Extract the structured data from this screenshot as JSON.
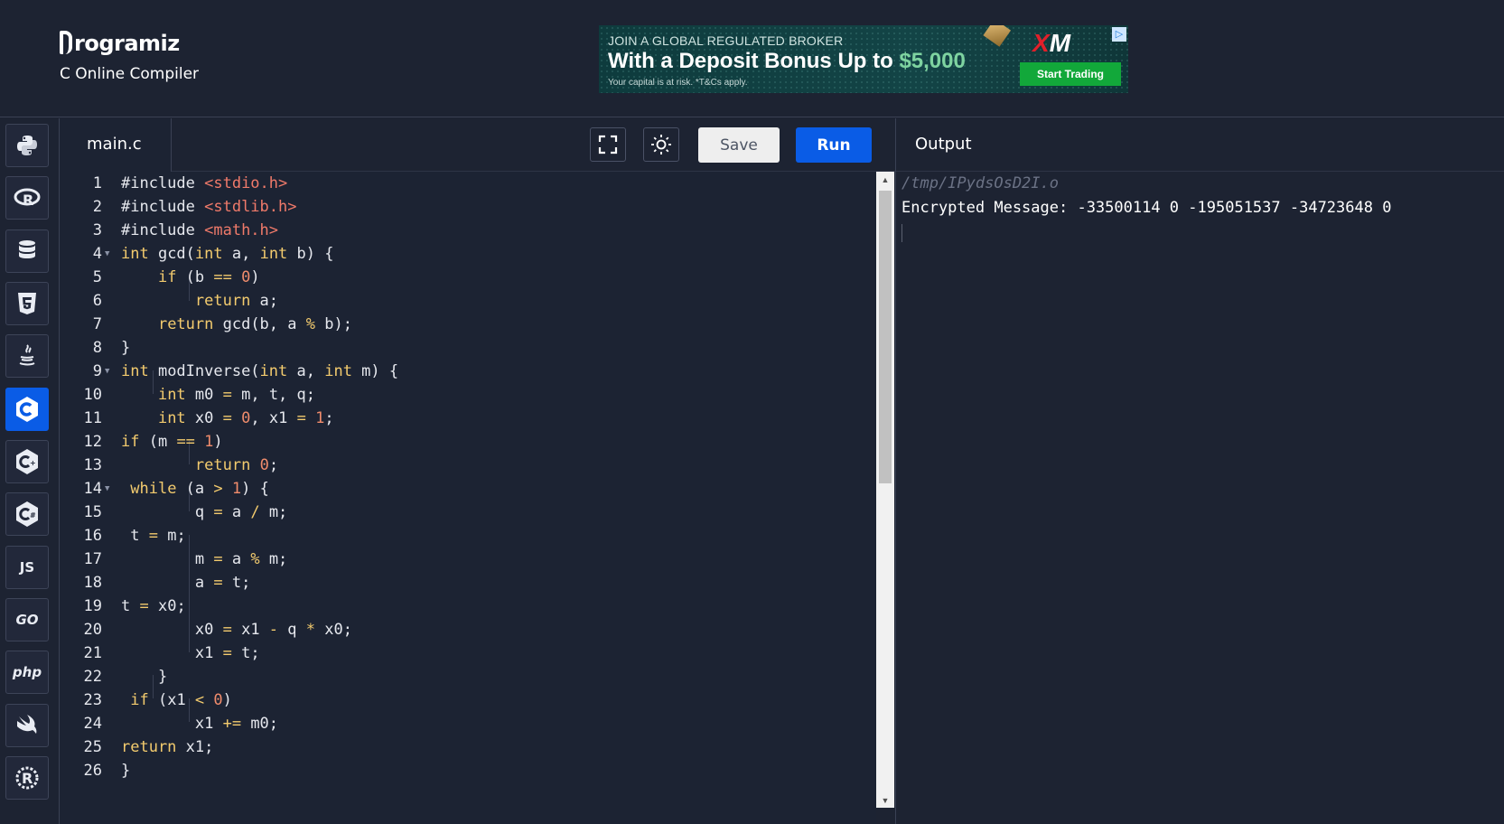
{
  "brand": {
    "name": "rogramiz",
    "subtitle": "C Online Compiler"
  },
  "ad": {
    "line1": "JOIN A GLOBAL REGULATED BROKER",
    "line2_prefix": "With a Deposit Bonus Up to ",
    "line2_amount": "$5,000",
    "line3": "Your capital is at risk. *T&Cs apply.",
    "logo_x": "X",
    "logo_m": "M",
    "badge": "▷",
    "cta": "Start Trading"
  },
  "sidebar": {
    "items": [
      {
        "name": "python",
        "label": ""
      },
      {
        "name": "r",
        "label": ""
      },
      {
        "name": "sql",
        "label": ""
      },
      {
        "name": "html",
        "label": ""
      },
      {
        "name": "java",
        "label": ""
      },
      {
        "name": "c",
        "label": ""
      },
      {
        "name": "cpp",
        "label": ""
      },
      {
        "name": "csharp",
        "label": ""
      },
      {
        "name": "js",
        "label": "JS"
      },
      {
        "name": "go",
        "label": "GO"
      },
      {
        "name": "php",
        "label": "php"
      },
      {
        "name": "swift",
        "label": ""
      },
      {
        "name": "rust",
        "label": ""
      }
    ],
    "active": "c"
  },
  "editor": {
    "tab": "main.c",
    "save_label": "Save",
    "run_label": "Run",
    "line_numbers": [
      "1",
      "2",
      "3",
      "4",
      "5",
      "6",
      "7",
      "8",
      "9",
      "10",
      "11",
      "12",
      "13",
      "14",
      "15",
      "16",
      "17",
      "18",
      "19",
      "20",
      "21",
      "22",
      "23",
      "24",
      "25",
      "26"
    ]
  },
  "output": {
    "title": "Output",
    "path": "/tmp/IPydsOsD2I.o",
    "text": "Encrypted Message: -33500114 0 -195051537 -34723648 0"
  },
  "colors": {
    "accent": "#0a5ce6",
    "background": "#1d2332",
    "keyword": "#f3cb6e",
    "number": "#f08c6c"
  }
}
